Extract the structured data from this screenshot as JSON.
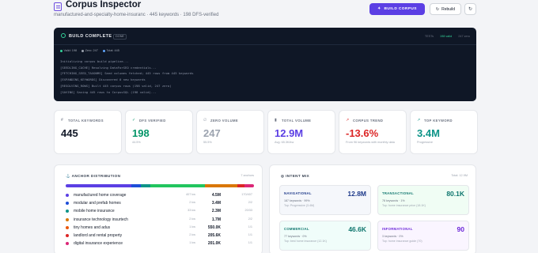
{
  "header": {
    "title": "Corpus Inspector",
    "subtitle": "manufactured-and-specialty-home-insuranc · 445 keywords · 198 DFS-verified",
    "build_button": "BUILD CORPUS",
    "rebuild_button": "Rebuild",
    "refresh_icon": "↻"
  },
  "terminal": {
    "status": "BUILD COMPLETE",
    "badge": "DONE",
    "stats": [
      "TESTs",
      "198 valid",
      "247 zero"
    ],
    "legend": [
      {
        "label": "Valid: 198",
        "color": "#34d399"
      },
      {
        "label": "Zero: 247",
        "color": "#9ca3af"
      },
      {
        "label": "Total: 445",
        "color": "#60a5fa"
      }
    ],
    "log": [
      "Initializing corpus build pipeline...",
      "[SEEDLING_CACHE] Resolving DataForSEO credentials...",
      "[FETCHING_SEED_TAXONMS] Seed volumes fetched; 445 rows from 445 keywords",
      "[EXPANDING_KEYWORDS] Discovered 0 new keywords",
      "[RESOLVING_ROWS] Built 445 corpus rows (198 valid, 247 zero)",
      "[SAVING] Saving 445 rows to CorpusSQL (198 valid)..."
    ]
  },
  "kpis": [
    {
      "icon": "#",
      "label": "TOTAL KEYWORDS",
      "value": "445",
      "sub": "",
      "color": "#111827",
      "icon_color": "#6b7280"
    },
    {
      "icon": "✓",
      "label": "DFS VERIFIED",
      "value": "198",
      "sub": "44.5%",
      "color": "#059669",
      "icon_color": "#059669"
    },
    {
      "icon": "∅",
      "label": "ZERO VOLUME",
      "value": "247",
      "sub": "55.5%",
      "color": "#9ca3af",
      "icon_color": "#9ca3af"
    },
    {
      "icon": "▮",
      "label": "TOTAL VOLUME",
      "value": "12.9M",
      "sub": "Avg: 65.3K/kw",
      "color": "#5b3fe4",
      "icon_color": "#6b7280"
    },
    {
      "icon": "↗",
      "label": "CORPUS TREND",
      "value": "-13.6%",
      "sub": "From 96 keywords with monthly data",
      "color": "#dc2626",
      "icon_color": "#dc2626"
    },
    {
      "icon": "↗",
      "label": "TOP KEYWORD",
      "value": "3.4M",
      "sub": "Progressive",
      "color": "#0d9488",
      "icon_color": "#0d9488"
    }
  ],
  "anchor": {
    "title": "ANCHOR DISTRIBUTION",
    "meta": "7 anchors",
    "bar": [
      {
        "color": "#5b3fe4",
        "share": 0.35
      },
      {
        "color": "#1d4ed8",
        "share": 0.05
      },
      {
        "color": "#0d9488",
        "share": 0.05
      },
      {
        "color": "#22c55e",
        "share": 0.29
      },
      {
        "color": "#d97706",
        "share": 0.17
      },
      {
        "color": "#dc2626",
        "share": 0.04
      },
      {
        "color": "#db2777",
        "share": 0.05
      }
    ],
    "rows": [
      {
        "name": "manufactured home coverage",
        "kw": "407 kw",
        "value": "4.5M",
        "ratio": "170/407",
        "color": "#5b3fe4"
      },
      {
        "name": "modular and prefab homes",
        "kw": "2 kw",
        "value": "3.4M",
        "ratio": "2/2",
        "color": "#1d4ed8"
      },
      {
        "name": "mobile home insurance",
        "kw": "33 kw",
        "value": "2.3M",
        "ratio": "20/33",
        "color": "#0d9488"
      },
      {
        "name": "insurance technology insurtech",
        "kw": "2 kw",
        "value": "1.7M",
        "ratio": "2/2",
        "color": "#d97706"
      },
      {
        "name": "tiny homes and adus",
        "kw": "1 kw",
        "value": "550.0K",
        "ratio": "1/1",
        "color": "#ea580c"
      },
      {
        "name": "landlord and rental property",
        "kw": "2 kw",
        "value": "205.6K",
        "ratio": "1/1",
        "color": "#dc2626"
      },
      {
        "name": "digital insurance experience",
        "kw": "1 kw",
        "value": "201.0K",
        "ratio": "1/1",
        "color": "#db2777"
      }
    ]
  },
  "intent": {
    "title": "INTENT MIX",
    "meta": "Total: 12.9M",
    "cards": [
      {
        "label": "NAVIGATIONAL",
        "value": "12.8M",
        "line1": "187 keywords · 99%",
        "line2": "Top: Progressive (3.4M)",
        "color": "#1e3a8a",
        "bg": "#f5f7fb"
      },
      {
        "label": "TRANSACTIONAL",
        "value": "80.1K",
        "line1": "78 keywords · 1%",
        "line2": "Top: home insurance price (18.1K)",
        "color": "#0f766e",
        "bg": "#f0fdf4"
      },
      {
        "label": "COMMERCIAL",
        "value": "46.6K",
        "line1": "77 keywords · 0%",
        "line2": "Top: best home insurance (12.1K)",
        "color": "#0f766e",
        "bg": "#f0fdfa"
      },
      {
        "label": "INFORMATIONAL",
        "value": "90",
        "line1": "3 keywords · 0%",
        "line2": "Top: home insurance guide (70)",
        "color": "#6d28d9",
        "bg": "#faf5ff"
      }
    ]
  }
}
